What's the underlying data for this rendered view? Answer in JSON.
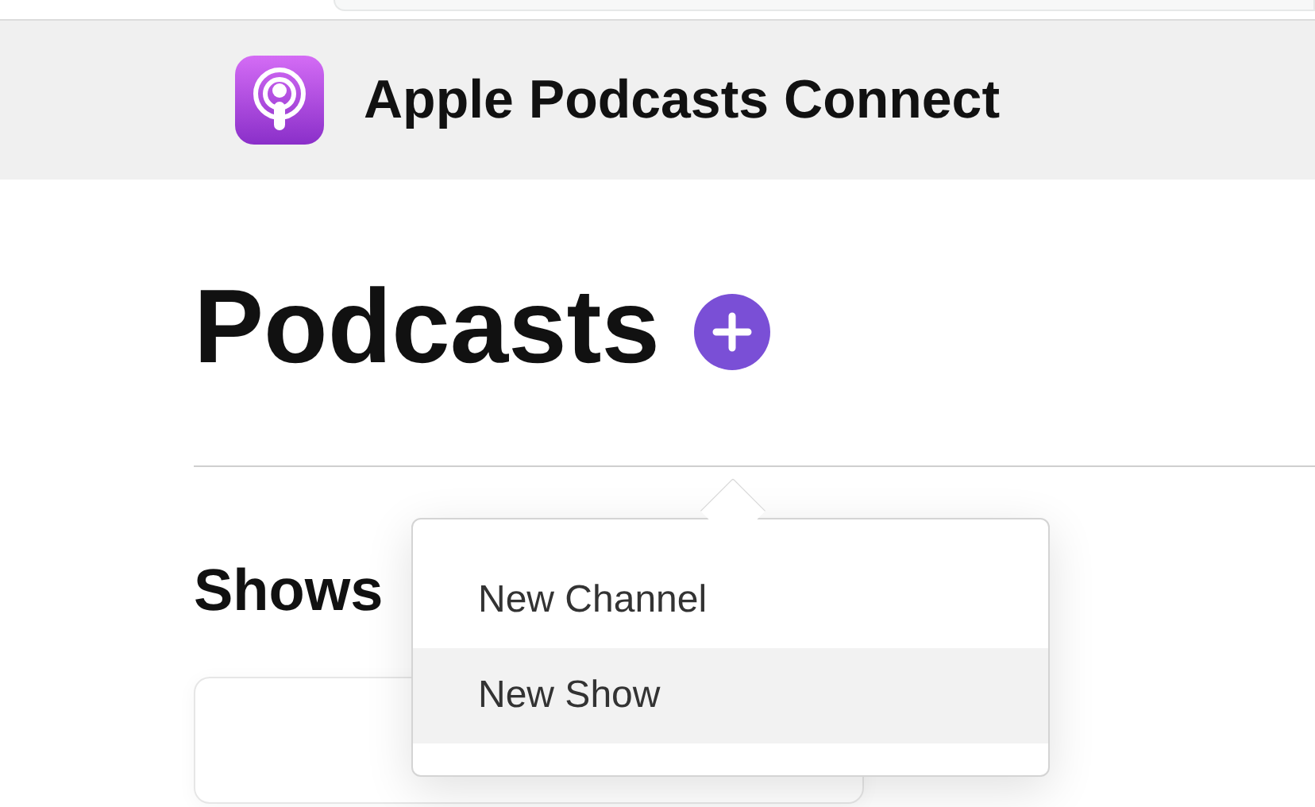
{
  "header": {
    "app_title": "Apple Podcasts Connect"
  },
  "page": {
    "title": "Podcasts"
  },
  "menu": {
    "open": true,
    "items": [
      {
        "label": "New Channel",
        "selected": false
      },
      {
        "label": "New Show",
        "selected": true
      }
    ]
  },
  "sections": [
    {
      "title": "Shows"
    }
  ]
}
